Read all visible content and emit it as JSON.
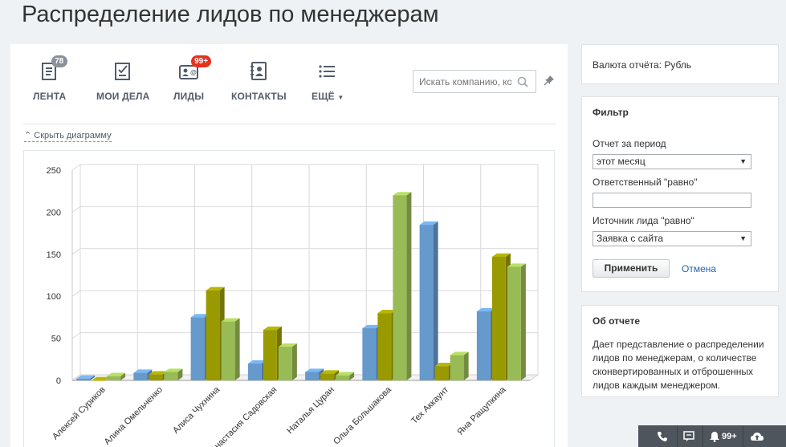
{
  "page": {
    "title": "Распределение лидов по менеджерам"
  },
  "toolbar": {
    "items": [
      {
        "label": "ЛЕНТА",
        "badge": "78",
        "icon": "feed-icon"
      },
      {
        "label": "МОИ ДЕЛА",
        "badge": "",
        "icon": "tasks-icon"
      },
      {
        "label": "ЛИДЫ",
        "badge": "99+",
        "icon": "leads-icon"
      },
      {
        "label": "КОНТАКТЫ",
        "badge": "",
        "icon": "contacts-icon"
      },
      {
        "label": "ЕЩЁ",
        "badge": "",
        "icon": "more-list-icon"
      }
    ],
    "search_placeholder": "Искать компанию, контакт..."
  },
  "chart_toggle": {
    "label": "Скрыть диаграмму"
  },
  "chart_data": {
    "type": "bar",
    "style": "3d",
    "categories": [
      "Алексей Суриков",
      "Алина Омельченко",
      "Алиса Чухнина",
      "Анастасия Садовская",
      "Наталья Цуран",
      "Ольга Большакова",
      "Тех Аккаунт",
      "Яна Ращупкина"
    ],
    "series": [
      {
        "color": "#6699cc",
        "values": [
          2,
          9,
          75,
          20,
          10,
          62,
          185,
          82
        ]
      },
      {
        "color": "#999900",
        "values": [
          0,
          7,
          107,
          60,
          8,
          80,
          17,
          147
        ]
      },
      {
        "color": "#99bb55",
        "values": [
          5,
          10,
          70,
          40,
          6,
          220,
          30,
          135
        ]
      }
    ],
    "ylim": [
      0,
      250
    ],
    "yticks": [
      0,
      50,
      100,
      150,
      200,
      250
    ],
    "grid": true,
    "legend": "none"
  },
  "sidebar": {
    "currency": "Валюта отчёта: Рубль",
    "filter": {
      "title": "Фильтр",
      "period_label": "Отчет за период",
      "period_value": "этот месяц",
      "responsible_label": "Ответственный \"равно\"",
      "responsible_value": "",
      "source_label": "Источник лида \"равно\"",
      "source_value": "Заявка с сайта",
      "apply_label": "Применить",
      "cancel_label": "Отмена"
    },
    "about": {
      "title": "Об отчете",
      "text": "Дает представление о распределении лидов по менеджерам, о количестве сконвертированных и отброшенных лидов каждым менеджером."
    }
  },
  "bottom_bar": {
    "notifications": "99+"
  }
}
